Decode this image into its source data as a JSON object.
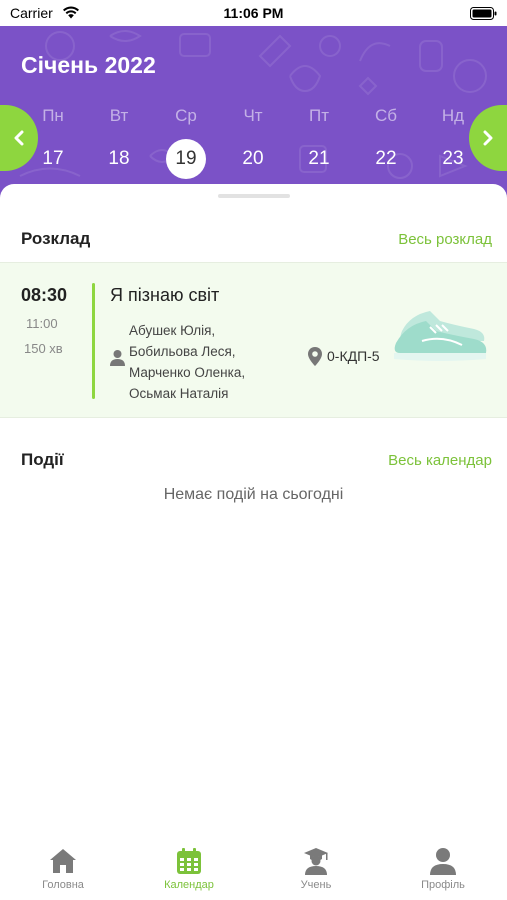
{
  "status_bar": {
    "carrier": "Carrier",
    "time": "11:06 PM"
  },
  "header": {
    "month_title": "Січень 2022",
    "weekdays": [
      "Пн",
      "Вт",
      "Ср",
      "Чт",
      "Пт",
      "Сб",
      "Нд"
    ],
    "dates": [
      "17",
      "18",
      "19",
      "20",
      "21",
      "22",
      "23"
    ],
    "selected_date": "19"
  },
  "schedule": {
    "title": "Розклад",
    "link": "Весь розклад",
    "lesson": {
      "start": "08:30",
      "end": "11:00",
      "duration": "150 хв",
      "title": "Я пізнаю світ",
      "teachers": [
        "Абушек Юлія,",
        "Бобильова Леся,",
        "Марченко Оленка,",
        "Осьмак Наталія"
      ],
      "room": "0-КДП-5"
    }
  },
  "events": {
    "title": "Події",
    "link": "Весь календар",
    "empty_text": "Немає подій на сьогодні"
  },
  "tabbar": {
    "items": [
      {
        "label": "Головна",
        "icon": "home-icon",
        "active": false
      },
      {
        "label": "Календар",
        "icon": "calendar-icon",
        "active": true
      },
      {
        "label": "Учень",
        "icon": "student-icon",
        "active": false
      },
      {
        "label": "Профіль",
        "icon": "profile-icon",
        "active": false
      }
    ]
  },
  "colors": {
    "header_bg": "#7b52c7",
    "accent_green": "#8ed63f",
    "link_green": "#7cc23a",
    "card_bg": "#f3fbee"
  }
}
